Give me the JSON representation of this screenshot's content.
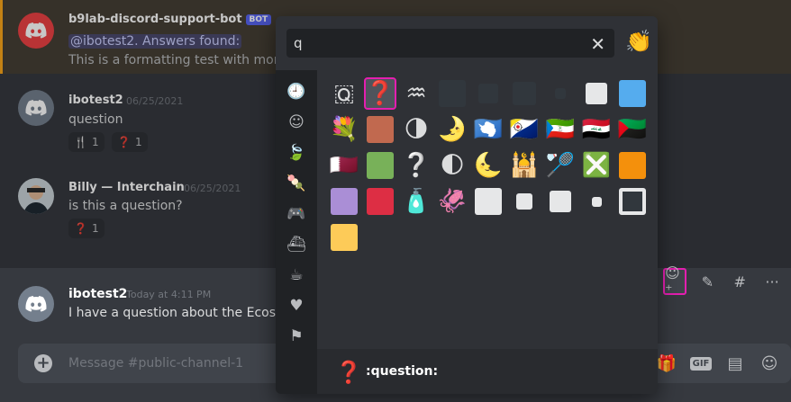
{
  "chat": {
    "messages": [
      {
        "author": "b9lab-discord-support-bot",
        "bot_tag": "BOT",
        "timestamp": "",
        "lines": [
          "@ibotest2. Answers found:",
          "This is a formatting test with more"
        ]
      },
      {
        "author": "ibotest2",
        "timestamp": "06/25/2021",
        "lines": [
          "question"
        ],
        "reactions": [
          {
            "emoji": "🍴",
            "count": "1"
          },
          {
            "emoji": "❓",
            "count": "1"
          }
        ]
      },
      {
        "author": "Billy — Interchain",
        "timestamp": "06/25/2021",
        "lines": [
          "is this a question?"
        ],
        "reactions": [
          {
            "emoji": "❓",
            "count": "1"
          }
        ]
      },
      {
        "author": "ibotest2",
        "timestamp": "Today at 4:11 PM",
        "lines": [
          "I have a question about the Ecosyst"
        ]
      }
    ],
    "mention": "@ibotest2",
    "message_placeholder": "Message #public-channel-1",
    "gif_label": "GIF"
  },
  "emoji_picker": {
    "search_value": "q",
    "skin_tone_emoji": "👏",
    "categories": [
      "recent-icon",
      "people-icon",
      "nature-icon",
      "food-icon",
      "activities-icon",
      "travel-icon",
      "objects-icon",
      "symbols-icon",
      "flags-icon"
    ],
    "results": [
      [
        "🇶",
        "❓",
        "♒",
        "",
        "",
        "",
        "",
        "◻",
        "🟦"
      ],
      [
        "💐",
        "🟫",
        "🌗",
        "🌛",
        "🇦🇶",
        "🇧🇶",
        "🇬🇶",
        "🇮🇶",
        "🇲🇶"
      ],
      [
        "🇶🇦",
        "🟩",
        "❔",
        "🌓",
        "🌜",
        "🕌",
        "🏸",
        "❎",
        "🟧"
      ],
      [
        "🟪",
        "🟥",
        "🧴",
        "🦑",
        "⬜",
        "◽",
        "◻",
        "▫",
        "🔲"
      ],
      [
        "🟨"
      ]
    ],
    "footer_emoji": "❓",
    "footer_name": ":question:"
  },
  "colors": {
    "accent": "#5865f2",
    "highlight": "#e41fb0"
  }
}
